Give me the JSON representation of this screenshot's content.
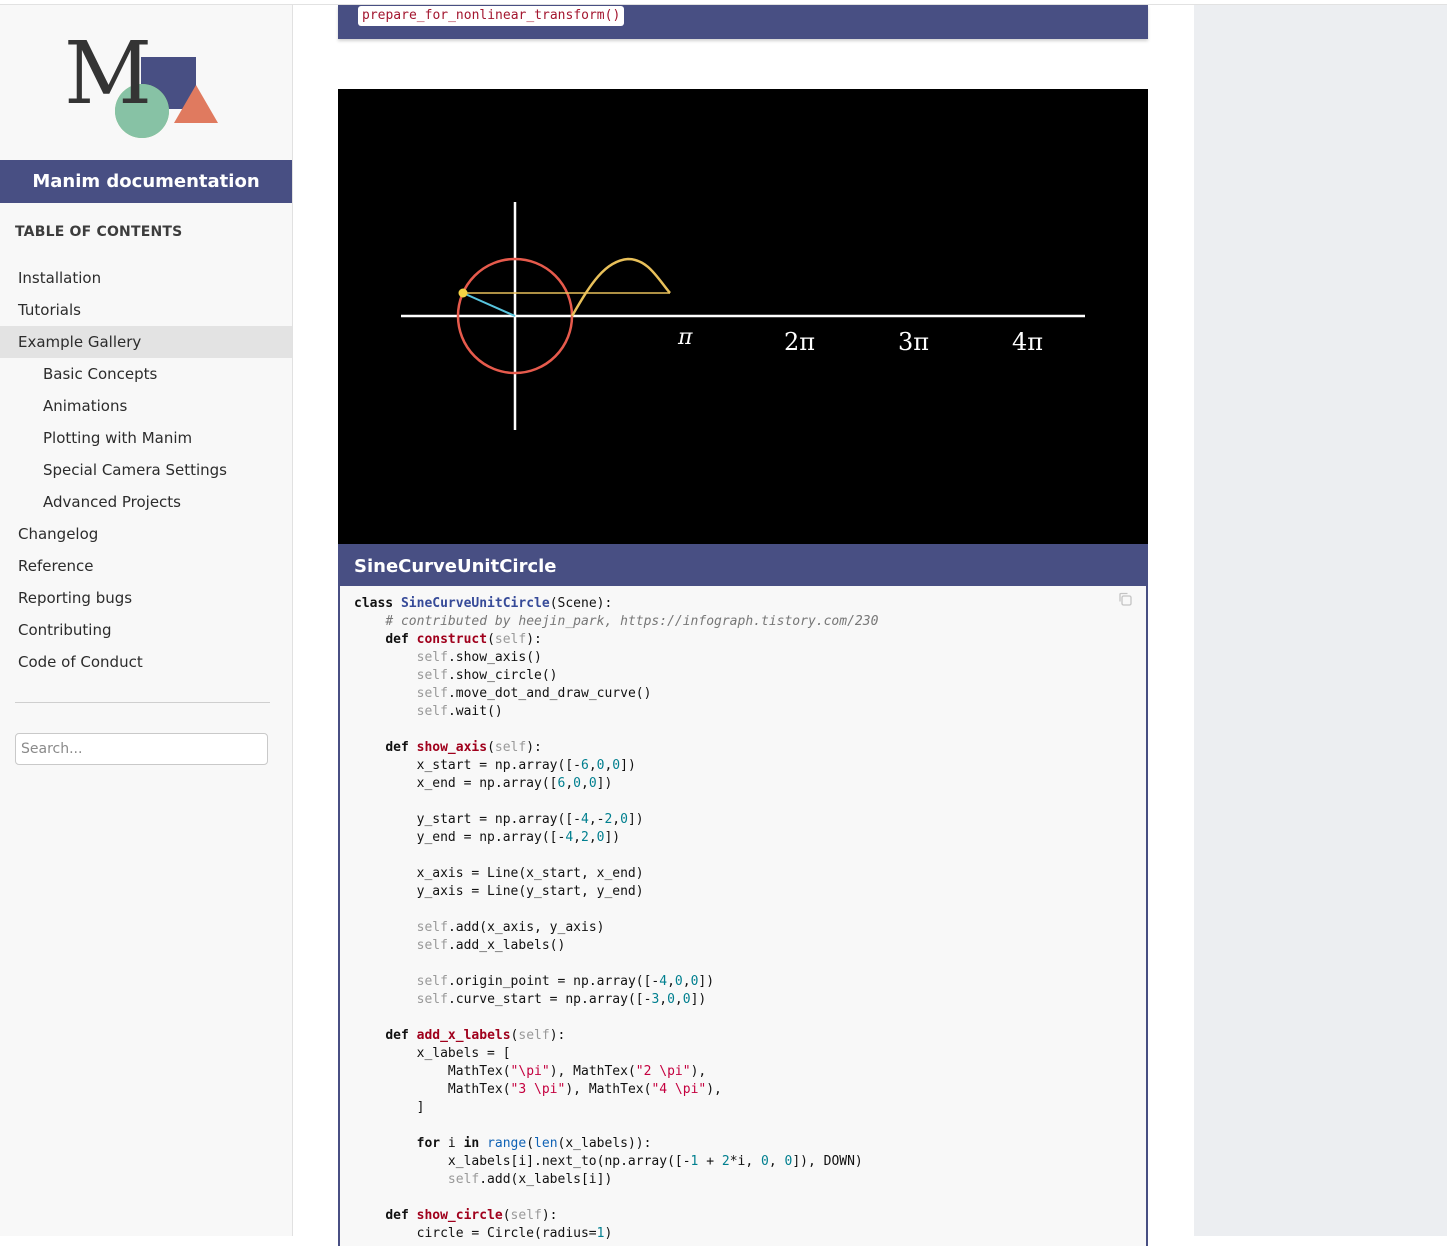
{
  "sidebar": {
    "logo_letter": "M",
    "project_title": "Manim documentation",
    "toc_heading": "TABLE OF CONTENTS",
    "items": [
      {
        "label": "Installation"
      },
      {
        "label": "Tutorials"
      },
      {
        "label": "Example Gallery"
      },
      {
        "label": "Basic Concepts"
      },
      {
        "label": "Animations"
      },
      {
        "label": "Plotting with Manim"
      },
      {
        "label": "Special Camera Settings"
      },
      {
        "label": "Advanced Projects"
      },
      {
        "label": "Changelog"
      },
      {
        "label": "Reference"
      },
      {
        "label": "Reporting bugs"
      },
      {
        "label": "Contributing"
      },
      {
        "label": "Code of Conduct"
      }
    ],
    "active_item": "Example Gallery",
    "search_placeholder": "Search..."
  },
  "main": {
    "top_code_ref": "prepare_for_nonlinear_transform()",
    "video": {
      "tick_labels": [
        "π",
        "2π",
        "3π",
        "4π"
      ],
      "colors": {
        "axis": "#ffffff",
        "circle": "#e65a4c",
        "curve": "#e8c05a",
        "radius": "#58c4dd",
        "dot": "#f4d345"
      }
    },
    "example_title": "SineCurveUnitCircle",
    "code": {
      "lines": [
        [
          [
            "kw",
            "class"
          ],
          [
            "",
            ""
          ],
          [
            "",
            " "
          ],
          [
            "cls",
            "SineCurveUnitCircle"
          ],
          [
            "",
            "(Scene):"
          ]
        ],
        [
          [
            "",
            "    "
          ],
          [
            "cmt",
            "# contributed by heejin_park, https://infograph.tistory.com/230"
          ]
        ],
        [
          [
            "",
            "    "
          ],
          [
            "kw",
            "def"
          ],
          [
            "",
            " "
          ],
          [
            "fn",
            "construct"
          ],
          [
            "",
            "("
          ],
          [
            "slf",
            "self"
          ],
          [
            "",
            "):"
          ]
        ],
        [
          [
            "",
            "        "
          ],
          [
            "slf",
            "self"
          ],
          [
            "",
            ".show_axis()"
          ]
        ],
        [
          [
            "",
            "        "
          ],
          [
            "slf",
            "self"
          ],
          [
            "",
            ".show_circle()"
          ]
        ],
        [
          [
            "",
            "        "
          ],
          [
            "slf",
            "self"
          ],
          [
            "",
            ".move_dot_and_draw_curve()"
          ]
        ],
        [
          [
            "",
            "        "
          ],
          [
            "slf",
            "self"
          ],
          [
            "",
            ".wait()"
          ]
        ],
        [
          [
            "",
            ""
          ]
        ],
        [
          [
            "",
            "    "
          ],
          [
            "kw",
            "def"
          ],
          [
            "",
            " "
          ],
          [
            "fn",
            "show_axis"
          ],
          [
            "",
            "("
          ],
          [
            "slf",
            "self"
          ],
          [
            "",
            "):"
          ]
        ],
        [
          [
            "",
            "        x_start = np.array([-"
          ],
          [
            "num",
            "6"
          ],
          [
            "",
            ","
          ],
          [
            "num",
            "0"
          ],
          [
            "",
            ","
          ],
          [
            "num",
            "0"
          ],
          [
            "",
            "])"
          ]
        ],
        [
          [
            "",
            "        x_end = np.array(["
          ],
          [
            "num",
            "6"
          ],
          [
            "",
            ","
          ],
          [
            "num",
            "0"
          ],
          [
            "",
            ","
          ],
          [
            "num",
            "0"
          ],
          [
            "",
            "])"
          ]
        ],
        [
          [
            "",
            ""
          ]
        ],
        [
          [
            "",
            "        y_start = np.array([-"
          ],
          [
            "num",
            "4"
          ],
          [
            "",
            ",-"
          ],
          [
            "num",
            "2"
          ],
          [
            "",
            ","
          ],
          [
            "num",
            "0"
          ],
          [
            "",
            "])"
          ]
        ],
        [
          [
            "",
            "        y_end = np.array([-"
          ],
          [
            "num",
            "4"
          ],
          [
            "",
            ","
          ],
          [
            "num",
            "2"
          ],
          [
            "",
            ","
          ],
          [
            "num",
            "0"
          ],
          [
            "",
            "])"
          ]
        ],
        [
          [
            "",
            ""
          ]
        ],
        [
          [
            "",
            "        x_axis = Line(x_start, x_end)"
          ]
        ],
        [
          [
            "",
            "        y_axis = Line(y_start, y_end)"
          ]
        ],
        [
          [
            "",
            ""
          ]
        ],
        [
          [
            "",
            "        "
          ],
          [
            "slf",
            "self"
          ],
          [
            "",
            ".add(x_axis, y_axis)"
          ]
        ],
        [
          [
            "",
            "        "
          ],
          [
            "slf",
            "self"
          ],
          [
            "",
            ".add_x_labels()"
          ]
        ],
        [
          [
            "",
            ""
          ]
        ],
        [
          [
            "",
            "        "
          ],
          [
            "slf",
            "self"
          ],
          [
            "",
            ".origin_point = np.array([-"
          ],
          [
            "num",
            "4"
          ],
          [
            "",
            ","
          ],
          [
            "num",
            "0"
          ],
          [
            "",
            ","
          ],
          [
            "num",
            "0"
          ],
          [
            "",
            "])"
          ]
        ],
        [
          [
            "",
            "        "
          ],
          [
            "slf",
            "self"
          ],
          [
            "",
            ".curve_start = np.array([-"
          ],
          [
            "num",
            "3"
          ],
          [
            "",
            ","
          ],
          [
            "num",
            "0"
          ],
          [
            "",
            ","
          ],
          [
            "num",
            "0"
          ],
          [
            "",
            "])"
          ]
        ],
        [
          [
            "",
            ""
          ]
        ],
        [
          [
            "",
            "    "
          ],
          [
            "kw",
            "def"
          ],
          [
            "",
            " "
          ],
          [
            "fn",
            "add_x_labels"
          ],
          [
            "",
            "("
          ],
          [
            "slf",
            "self"
          ],
          [
            "",
            "):"
          ]
        ],
        [
          [
            "",
            "        x_labels = ["
          ]
        ],
        [
          [
            "",
            "            MathTex("
          ],
          [
            "str",
            "\"\\pi\""
          ],
          [
            "",
            "), MathTex("
          ],
          [
            "str",
            "\"2 \\pi\""
          ],
          [
            "",
            "),"
          ]
        ],
        [
          [
            "",
            "            MathTex("
          ],
          [
            "str",
            "\"3 \\pi\""
          ],
          [
            "",
            "), MathTex("
          ],
          [
            "str",
            "\"4 \\pi\""
          ],
          [
            "",
            "),"
          ]
        ],
        [
          [
            "",
            "        ]"
          ]
        ],
        [
          [
            "",
            ""
          ]
        ],
        [
          [
            "",
            "        "
          ],
          [
            "kw",
            "for"
          ],
          [
            "",
            " i "
          ],
          [
            "kw",
            "in"
          ],
          [
            "",
            " "
          ],
          [
            "bi",
            "range"
          ],
          [
            "",
            "("
          ],
          [
            "bi",
            "len"
          ],
          [
            "",
            "(x_labels)):"
          ]
        ],
        [
          [
            "",
            "            x_labels[i].next_to(np.array([-"
          ],
          [
            "num",
            "1"
          ],
          [
            "",
            " + "
          ],
          [
            "num",
            "2"
          ],
          [
            "",
            "*i, "
          ],
          [
            "num",
            "0"
          ],
          [
            "",
            ", "
          ],
          [
            "num",
            "0"
          ],
          [
            "",
            "]), DOWN)"
          ]
        ],
        [
          [
            "",
            "            "
          ],
          [
            "slf",
            "self"
          ],
          [
            "",
            ".add(x_labels[i])"
          ]
        ],
        [
          [
            "",
            ""
          ]
        ],
        [
          [
            "",
            "    "
          ],
          [
            "kw",
            "def"
          ],
          [
            "",
            " "
          ],
          [
            "fn",
            "show_circle"
          ],
          [
            "",
            "("
          ],
          [
            "slf",
            "self"
          ],
          [
            "",
            "):"
          ]
        ],
        [
          [
            "",
            "        circle = Circle(radius="
          ],
          [
            "num",
            "1"
          ],
          [
            "",
            ")"
          ]
        ]
      ]
    }
  }
}
